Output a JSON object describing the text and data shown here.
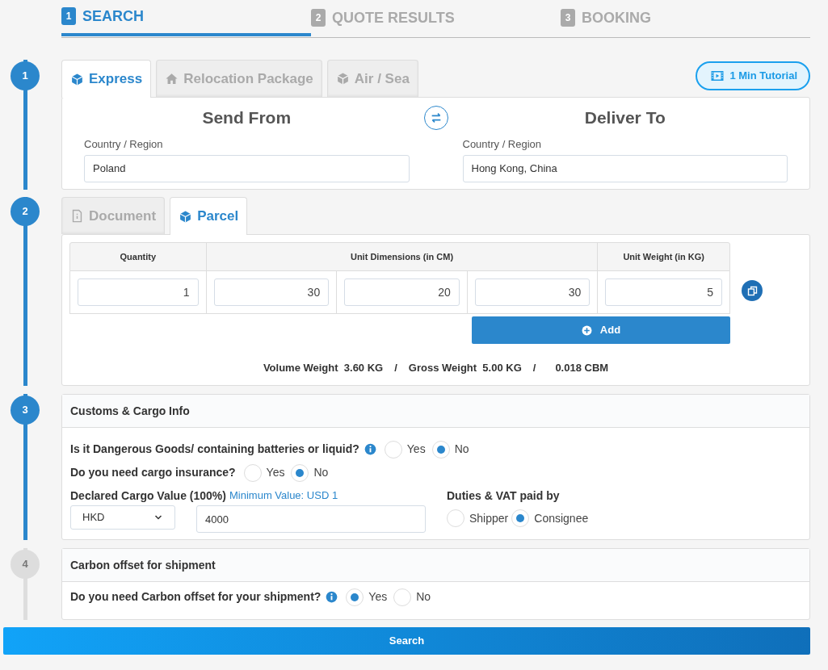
{
  "steps": [
    {
      "number": "1",
      "label": "SEARCH",
      "selected": true
    },
    {
      "number": "2",
      "label": "QUOTE RESULTS",
      "selected": false
    },
    {
      "number": "3",
      "label": "BOOKING",
      "selected": false
    }
  ],
  "route": {
    "step": "1",
    "active": true,
    "tabs": [
      {
        "label": "Express",
        "kind": "cube",
        "selected": true
      },
      {
        "label": "Relocation Package",
        "kind": "house",
        "selected": false
      },
      {
        "label": "Air / Sea",
        "kind": "cube",
        "selected": false
      }
    ],
    "tutorial_button": "1 Min Tutorial",
    "from": {
      "heading": "Send From",
      "label": "Country / Region",
      "value": "Poland"
    },
    "to": {
      "heading": "Deliver To",
      "label": "Country / Region",
      "value": "Hong Kong, China"
    }
  },
  "package": {
    "step": "2",
    "active": true,
    "tabs": [
      {
        "label": "Document",
        "kind": "document",
        "selected": false
      },
      {
        "label": "Parcel",
        "kind": "cube",
        "selected": true
      }
    ],
    "headers": [
      "Quantity",
      "Unit Dimensions (in CM)",
      "Unit Weight (in KG)"
    ],
    "values": [
      "1",
      "30",
      "20",
      "30",
      "5"
    ],
    "add_button": "Add",
    "summary": [
      {
        "label": "Volume Weight",
        "value": "3.60 KG"
      },
      {
        "label": "Gross Weight",
        "value": "5.00 KG"
      },
      {
        "value": "0.018 CBM"
      }
    ],
    "separator": "/"
  },
  "customs": {
    "step": "3",
    "active": true,
    "title": "Customs & Cargo Info",
    "questions": [
      {
        "label": "Is it Dangerous Goods/ containing batteries or liquid?",
        "info": true,
        "options": [
          {
            "label": "Yes",
            "selected": false
          },
          {
            "label": "No",
            "selected": true
          }
        ]
      },
      {
        "label": "Do you need cargo insurance?",
        "info": false,
        "options": [
          {
            "label": "Yes",
            "selected": false
          },
          {
            "label": "No",
            "selected": true
          }
        ]
      }
    ],
    "declared": {
      "label": "Declared Cargo Value (100%)",
      "hint": "Minimum Value: USD 1",
      "currency": "HKD",
      "value": "4000"
    },
    "duties": {
      "label": "Duties & VAT paid by",
      "options": [
        {
          "label": "Shipper",
          "selected": false
        },
        {
          "label": "Consignee",
          "selected": true
        }
      ]
    }
  },
  "carbon": {
    "step": "4",
    "active": false,
    "title": "Carbon offset for shipment",
    "questions": [
      {
        "label": "Do you need Carbon offset for your shipment?",
        "info": true,
        "options": [
          {
            "label": "Yes",
            "selected": true
          },
          {
            "label": "No",
            "selected": false
          }
        ]
      }
    ]
  },
  "search_button": "Search"
}
